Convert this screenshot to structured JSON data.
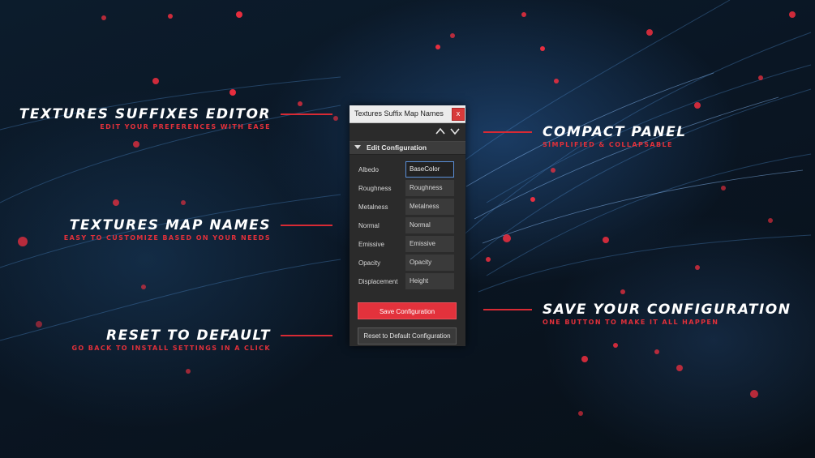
{
  "callouts": {
    "suffixes_editor": {
      "title": "Textures Suffixes Editor",
      "subtitle": "Edit your preferences with ease"
    },
    "map_names": {
      "title": "Textures Map Names",
      "subtitle": "Easy to customize based on your needs"
    },
    "reset_default": {
      "title": "Reset to Default",
      "subtitle": "Go back to install settings in a click"
    },
    "compact_panel": {
      "title": "Compact Panel",
      "subtitle": "Simplified & Collapsable"
    },
    "save_config": {
      "title": "Save Your Configuration",
      "subtitle": "One button to make it all happen"
    }
  },
  "panel": {
    "title": "Textures Suffix Map Names",
    "close_label": "x",
    "section_label": "Edit Configuration",
    "rows": [
      {
        "label": "Albedo",
        "value": "BaseColor"
      },
      {
        "label": "Roughness",
        "value": "Roughness"
      },
      {
        "label": "Metalness",
        "value": "Metalness"
      },
      {
        "label": "Normal",
        "value": "Normal"
      },
      {
        "label": "Emissive",
        "value": "Emissive"
      },
      {
        "label": "Opacity",
        "value": "Opacity"
      },
      {
        "label": "Displacement",
        "value": "Height"
      }
    ],
    "save_label": "Save Configuration",
    "reset_label": "Reset to Default Configuration"
  },
  "colors": {
    "accent": "#e3323c",
    "background": "#0a1420",
    "panel": "#2b2b2b",
    "focus": "#5a8fd8"
  },
  "icons": {
    "close": "close-icon",
    "up": "chevron-up-icon",
    "down": "chevron-down-icon",
    "collapse": "triangle-down-icon"
  }
}
